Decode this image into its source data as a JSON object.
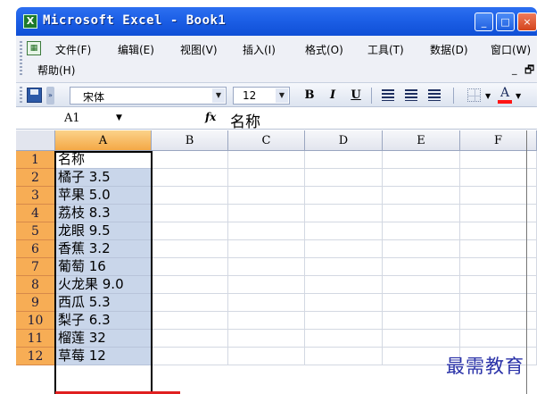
{
  "window": {
    "title": "Microsoft Excel - Book1",
    "app_icon": "excel-icon",
    "controls": [
      "minimize-icon",
      "maximize-icon",
      "close-icon"
    ]
  },
  "menubar": {
    "items": [
      {
        "label": "文件(F)"
      },
      {
        "label": "编辑(E)"
      },
      {
        "label": "视图(V)"
      },
      {
        "label": "插入(I)"
      },
      {
        "label": "格式(O)"
      },
      {
        "label": "工具(T)"
      },
      {
        "label": "数据(D)"
      },
      {
        "label": "窗口(W)"
      }
    ],
    "help": "帮助(H)",
    "min_glyph": "_",
    "restore_glyph": "🗗"
  },
  "toolbar": {
    "font_name": "宋体",
    "font_size": "12",
    "bold": "B",
    "italic": "I",
    "underline": "U",
    "font_color_glyph": "A",
    "accent_color": "#ff1414"
  },
  "formula_bar": {
    "name_box": "A1",
    "fx": "fx",
    "value": "名称"
  },
  "sheet": {
    "columns": [
      "A",
      "B",
      "C",
      "D",
      "E",
      "F"
    ],
    "active_column": "A",
    "rows": [
      {
        "num": "1",
        "a": "名称"
      },
      {
        "num": "2",
        "a": "橘子 3.5"
      },
      {
        "num": "3",
        "a": "苹果 5.0"
      },
      {
        "num": "4",
        "a": "荔枝 8.3"
      },
      {
        "num": "5",
        "a": "龙眼 9.5"
      },
      {
        "num": "6",
        "a": "香蕉 3.2"
      },
      {
        "num": "7",
        "a": "葡萄 16"
      },
      {
        "num": "8",
        "a": "火龙果 9.0"
      },
      {
        "num": "9",
        "a": "西瓜 5.3"
      },
      {
        "num": "10",
        "a": "梨子 6.3"
      },
      {
        "num": "11",
        "a": "榴莲 32"
      },
      {
        "num": "12",
        "a": "草莓 12"
      }
    ]
  },
  "watermark": "最需教育"
}
